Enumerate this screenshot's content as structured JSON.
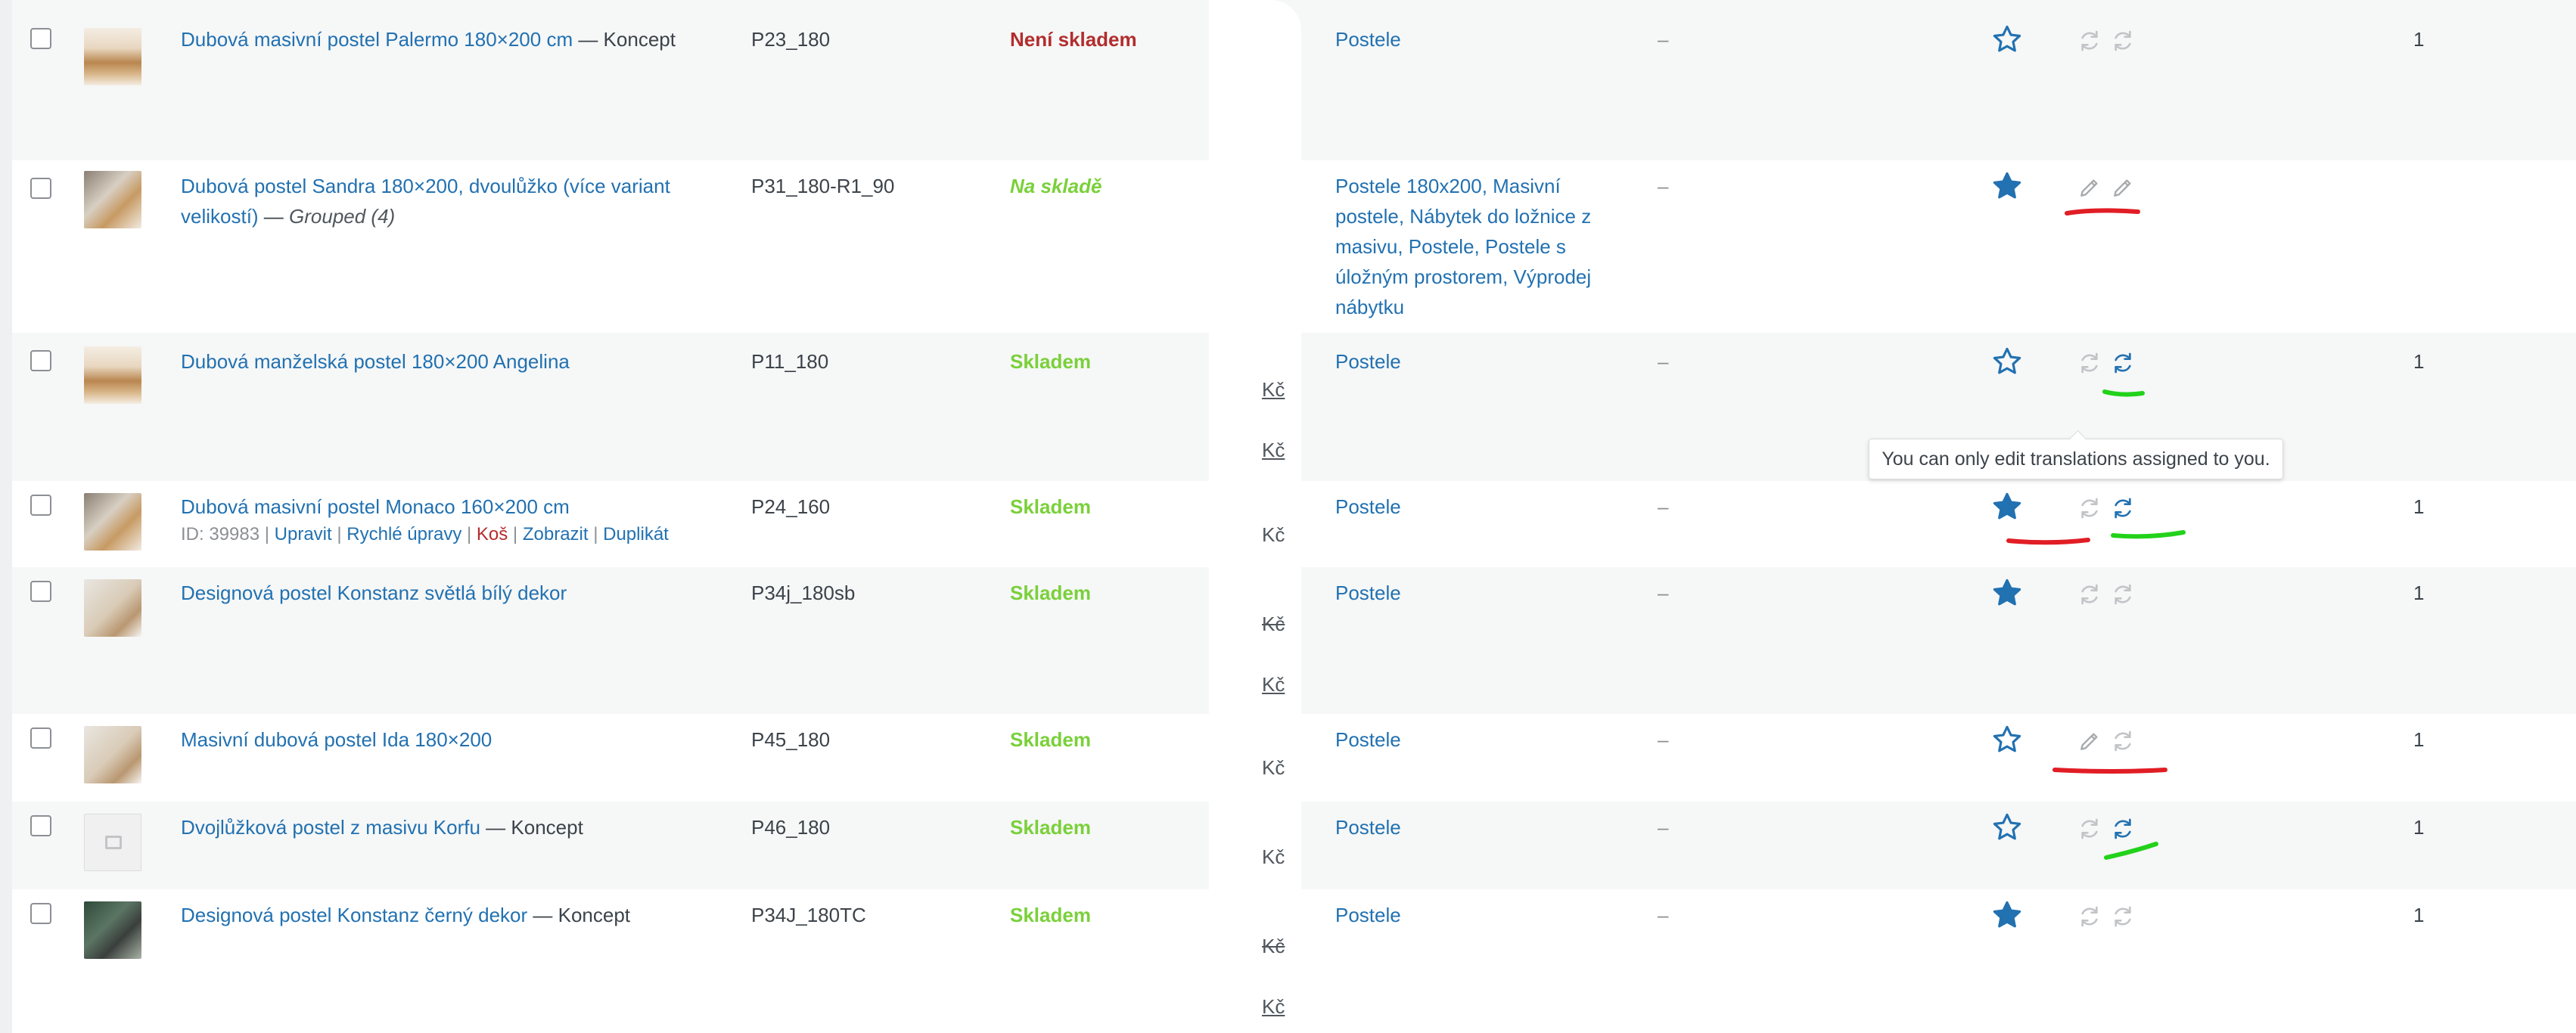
{
  "colors": {
    "link": "#2271b1",
    "out_of_stock": "#b32d2e",
    "in_stock": "#7ad03a",
    "featured_star": "#2271b1",
    "annotation_red": "#e11d25",
    "annotation_green": "#22d21a"
  },
  "tooltip": "You can only edit translations assigned to you.",
  "currency_fragment": "Kč",
  "rows": [
    {
      "name": "Dubová masivní postel Palermo 180×200 cm",
      "suffix": " — Koncept",
      "sku": "P23_180",
      "stock": "Není skladem",
      "categories": "Postele",
      "tags": "–",
      "featured": false,
      "count": "1",
      "translation_icons": [
        "sync-icon",
        "sync-icon"
      ]
    },
    {
      "name": "Dubová postel Sandra 180×200, dvoulůžko (více variant velikostí)",
      "suffix": " — ",
      "type": "Grouped (4)",
      "sku": "P31_180-R1_90",
      "stock": "Na skladě",
      "categories": "Postele 180x200, Masivní postele, Nábytek do ložnice z masivu, Postele, Postele s úložným prostorem, Výprodej nábytku",
      "tags": "–",
      "featured": true,
      "count": "",
      "translation_icons": [
        "pencil-icon",
        "pencil-icon"
      ]
    },
    {
      "name": "Dubová manželská postel 180×200 Angelina",
      "suffix": "",
      "sku": "P11_180",
      "stock": "Skladem",
      "categories": "Postele",
      "tags": "–",
      "featured": false,
      "count": "1",
      "translation_icons": [
        "sync-icon",
        "sync-icon"
      ]
    },
    {
      "name": "Dubová masivní postel Monaco 160×200 cm",
      "suffix": "",
      "sku": "P24_160",
      "stock": "Skladem",
      "categories": "Postele",
      "tags": "–",
      "featured": true,
      "count": "1",
      "translation_icons": [
        "sync-icon",
        "sync-icon"
      ],
      "row_actions": {
        "id": "ID: 39983",
        "edit": "Upravit",
        "quick_edit": "Rychlé úpravy",
        "trash": "Koš",
        "view": "Zobrazit",
        "duplicate": "Duplikát"
      }
    },
    {
      "name": "Designová postel Konstanz světlá bílý dekor",
      "suffix": "",
      "sku": "P34j_180sb",
      "stock": "Skladem",
      "categories": "Postele",
      "tags": "–",
      "featured": true,
      "count": "1",
      "translation_icons": [
        "sync-icon",
        "sync-icon"
      ]
    },
    {
      "name": "Masivní dubová postel Ida 180×200",
      "suffix": "",
      "sku": "P45_180",
      "stock": "Skladem",
      "categories": "Postele",
      "tags": "–",
      "featured": false,
      "count": "1",
      "translation_icons": [
        "pencil-icon",
        "sync-icon"
      ]
    },
    {
      "name": "Dvojlůžková postel z masivu Korfu",
      "suffix": " — Koncept",
      "sku": "P46_180",
      "stock": "Skladem",
      "categories": "Postele",
      "tags": "–",
      "featured": false,
      "count": "1",
      "translation_icons": [
        "sync-icon",
        "sync-icon"
      ]
    },
    {
      "name": "Designová postel Konstanz černý dekor",
      "suffix": " — Koncept",
      "sku": "P34J_180TC",
      "stock": "Skladem",
      "categories": "Postele",
      "tags": "–",
      "featured": true,
      "count": "1",
      "translation_icons": [
        "sync-icon",
        "sync-icon"
      ]
    }
  ]
}
